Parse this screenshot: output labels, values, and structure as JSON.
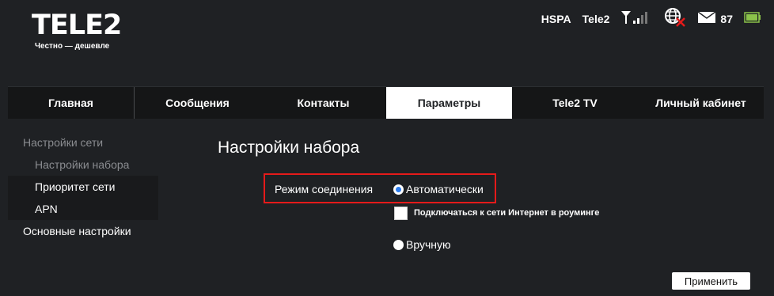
{
  "brand": {
    "logo": "TELE2",
    "slogan": "Честно — дешевле"
  },
  "status": {
    "network_type": "HSPA",
    "operator": "Tele2",
    "mail_count": "87"
  },
  "icons": {
    "signal": "signal-strength-icon",
    "internet": "globe-disconnected-icon",
    "mail": "envelope-icon",
    "battery": "battery-icon"
  },
  "colors": {
    "accent_radio": "#2c7df0",
    "highlight_border": "#e51a1a",
    "battery": "#8bc34a"
  },
  "tabs": [
    {
      "label": "Главная"
    },
    {
      "label": "Сообщения"
    },
    {
      "label": "Контакты"
    },
    {
      "label": "Параметры",
      "active": true
    },
    {
      "label": "Tele2 TV"
    },
    {
      "label": "Личный кабинет"
    }
  ],
  "sidebar": {
    "items": [
      {
        "label": "Настройки сети"
      },
      {
        "label": "Настройки набора"
      },
      {
        "label": "Приоритет сети"
      },
      {
        "label": "APN"
      },
      {
        "label": "Основные настройки"
      }
    ]
  },
  "main": {
    "title": "Настройки набора",
    "connection_mode_label": "Режим соединения",
    "auto_option": "Автоматически",
    "roaming_checkbox_label": "Подключаться к сети Интернет в роуминге",
    "manual_option": "Вручную",
    "apply_button": "Применить"
  }
}
